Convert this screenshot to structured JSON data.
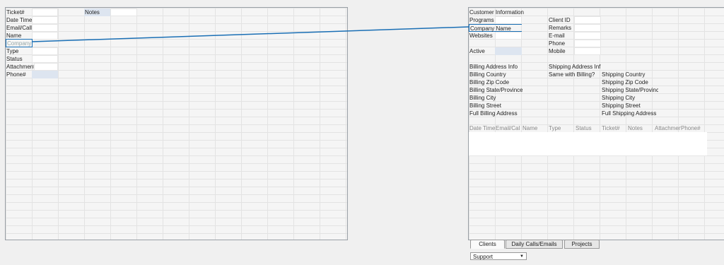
{
  "left_form": {
    "ticket_label": "Ticket#",
    "notes_label": "Notes",
    "datetime_label": "Date Time",
    "emailcall_label": "Email/Call",
    "name_label": "Name",
    "company_placeholder": "Company",
    "type_label": "Type",
    "status_label": "Status",
    "attachment_label": "Attachment",
    "phone_label": "Phone#"
  },
  "customer_info": {
    "title": "Customer Information",
    "programs_label": "Programs",
    "client_id_label": "Client ID",
    "company_name_label": "Company Name",
    "remarks_label": "Remarks",
    "websites_label": "Websites",
    "email_label": "E-mail",
    "phone_label": "Phone",
    "active_label": "Active",
    "mobile_label": "Mobile",
    "billing_header": "Billing Address Info",
    "shipping_header": "Shipping Address Inf",
    "billing_country": "Billing Country",
    "same_with_billing": "Same with Billing?",
    "shipping_country": "Shipping Country",
    "billing_zip": "Billing Zip Code",
    "shipping_zip": "Shipping Zip Code",
    "billing_state": "Billing State/Province",
    "shipping_state": "Shipping State/Province",
    "billing_city": "Billing City",
    "shipping_city": "Shipping City",
    "billing_street": "Billing Street",
    "shipping_street": "Shipping Street",
    "full_billing": "Full Billing Address",
    "full_shipping": "Full Shipping Address"
  },
  "history_table": {
    "columns": [
      "Date Time",
      "Email/Cal",
      "Name",
      "Type",
      "Status",
      "Ticket#",
      "Notes",
      "Attachmen",
      "Phone#"
    ]
  },
  "tabs": [
    {
      "label": "Clients"
    },
    {
      "label": "Daily Calls/Emails"
    },
    {
      "label": "Projects"
    }
  ],
  "dropdown": {
    "value": "Support"
  },
  "colors": {
    "link_line": "#1a6fb5",
    "input_blue": "#dde5f0"
  }
}
